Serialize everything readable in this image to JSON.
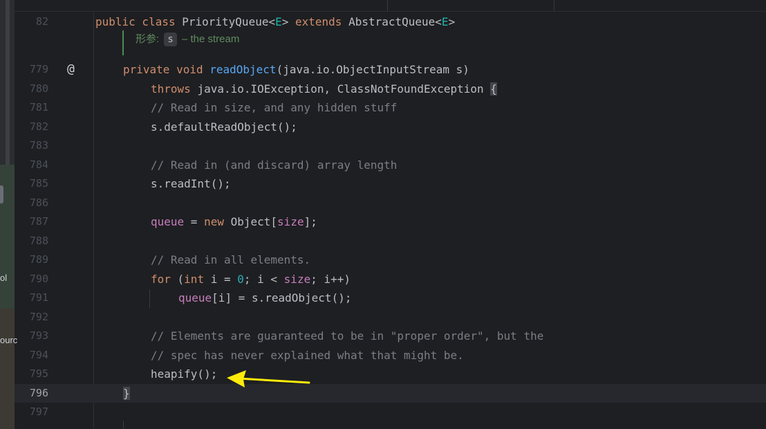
{
  "sidebar_fragment": {
    "text_1": "ol",
    "text_2": "ourc"
  },
  "gutter": {
    "at_icon": "@"
  },
  "doc_hint": {
    "label": "形参:",
    "param": "s",
    "description": "– the stream"
  },
  "lines": [
    {
      "number": "82",
      "tokens": [
        {
          "t": "public class ",
          "c": "kw"
        },
        {
          "t": "PriorityQueue<",
          "c": ""
        },
        {
          "t": "E",
          "c": "tp"
        },
        {
          "t": "> ",
          "c": ""
        },
        {
          "t": "extends ",
          "c": "kw"
        },
        {
          "t": "AbstractQueue<",
          "c": ""
        },
        {
          "t": "E",
          "c": "tp"
        },
        {
          "t": ">",
          "c": ""
        }
      ]
    },
    {
      "number": "779",
      "tokens": [
        {
          "t": "private void ",
          "c": "kw"
        },
        {
          "t": "readObject",
          "c": "fn"
        },
        {
          "t": "(java.io.ObjectInputStream s)",
          "c": ""
        }
      ]
    },
    {
      "number": "780",
      "tokens": [
        {
          "t": "throws ",
          "c": "kw"
        },
        {
          "t": "java.io.IOException, ClassNotFoundException ",
          "c": ""
        },
        {
          "t": "{",
          "c": "brace"
        }
      ]
    },
    {
      "number": "781",
      "tokens": [
        {
          "t": "// Read in size, and any hidden stuff",
          "c": "cmt"
        }
      ]
    },
    {
      "number": "782",
      "tokens": [
        {
          "t": "s.defaultReadObject();",
          "c": ""
        }
      ]
    },
    {
      "number": "783",
      "tokens": []
    },
    {
      "number": "784",
      "tokens": [
        {
          "t": "// Read in (and discard) array length",
          "c": "cmt"
        }
      ]
    },
    {
      "number": "785",
      "tokens": [
        {
          "t": "s.readInt();",
          "c": ""
        }
      ]
    },
    {
      "number": "786",
      "tokens": []
    },
    {
      "number": "787",
      "tokens": [
        {
          "t": "queue",
          "c": "field"
        },
        {
          "t": " = ",
          "c": ""
        },
        {
          "t": "new ",
          "c": "kw"
        },
        {
          "t": "Object[",
          "c": ""
        },
        {
          "t": "size",
          "c": "field"
        },
        {
          "t": "];",
          "c": ""
        }
      ]
    },
    {
      "number": "788",
      "tokens": []
    },
    {
      "number": "789",
      "tokens": [
        {
          "t": "// Read in all elements.",
          "c": "cmt"
        }
      ]
    },
    {
      "number": "790",
      "tokens": [
        {
          "t": "for ",
          "c": "kw"
        },
        {
          "t": "(",
          "c": ""
        },
        {
          "t": "int ",
          "c": "kw"
        },
        {
          "t": "i = ",
          "c": ""
        },
        {
          "t": "0",
          "c": "num"
        },
        {
          "t": "; i < ",
          "c": ""
        },
        {
          "t": "size",
          "c": "field"
        },
        {
          "t": "; i++)",
          "c": ""
        }
      ]
    },
    {
      "number": "791",
      "tokens": [
        {
          "t": "queue",
          "c": "field"
        },
        {
          "t": "[i] = s.readObject();",
          "c": ""
        }
      ]
    },
    {
      "number": "792",
      "tokens": []
    },
    {
      "number": "793",
      "tokens": [
        {
          "t": "// Elements are guaranteed to be in \"proper order\", but the",
          "c": "cmt"
        }
      ]
    },
    {
      "number": "794",
      "tokens": [
        {
          "t": "// spec has never explained what that might be.",
          "c": "cmt"
        }
      ]
    },
    {
      "number": "795",
      "tokens": [
        {
          "t": "heapify();",
          "c": ""
        }
      ]
    },
    {
      "number": "796",
      "tokens": [
        {
          "t": "}",
          "c": "brace"
        }
      ]
    },
    {
      "number": "797",
      "tokens": []
    }
  ],
  "colors": {
    "keyword": "#cf8e6d",
    "function": "#56a8f5",
    "field": "#c77dbb",
    "number": "#2aacb8",
    "comment": "#7a7e85",
    "type_param": "#16baac",
    "arrow": "#ffeb0a"
  }
}
